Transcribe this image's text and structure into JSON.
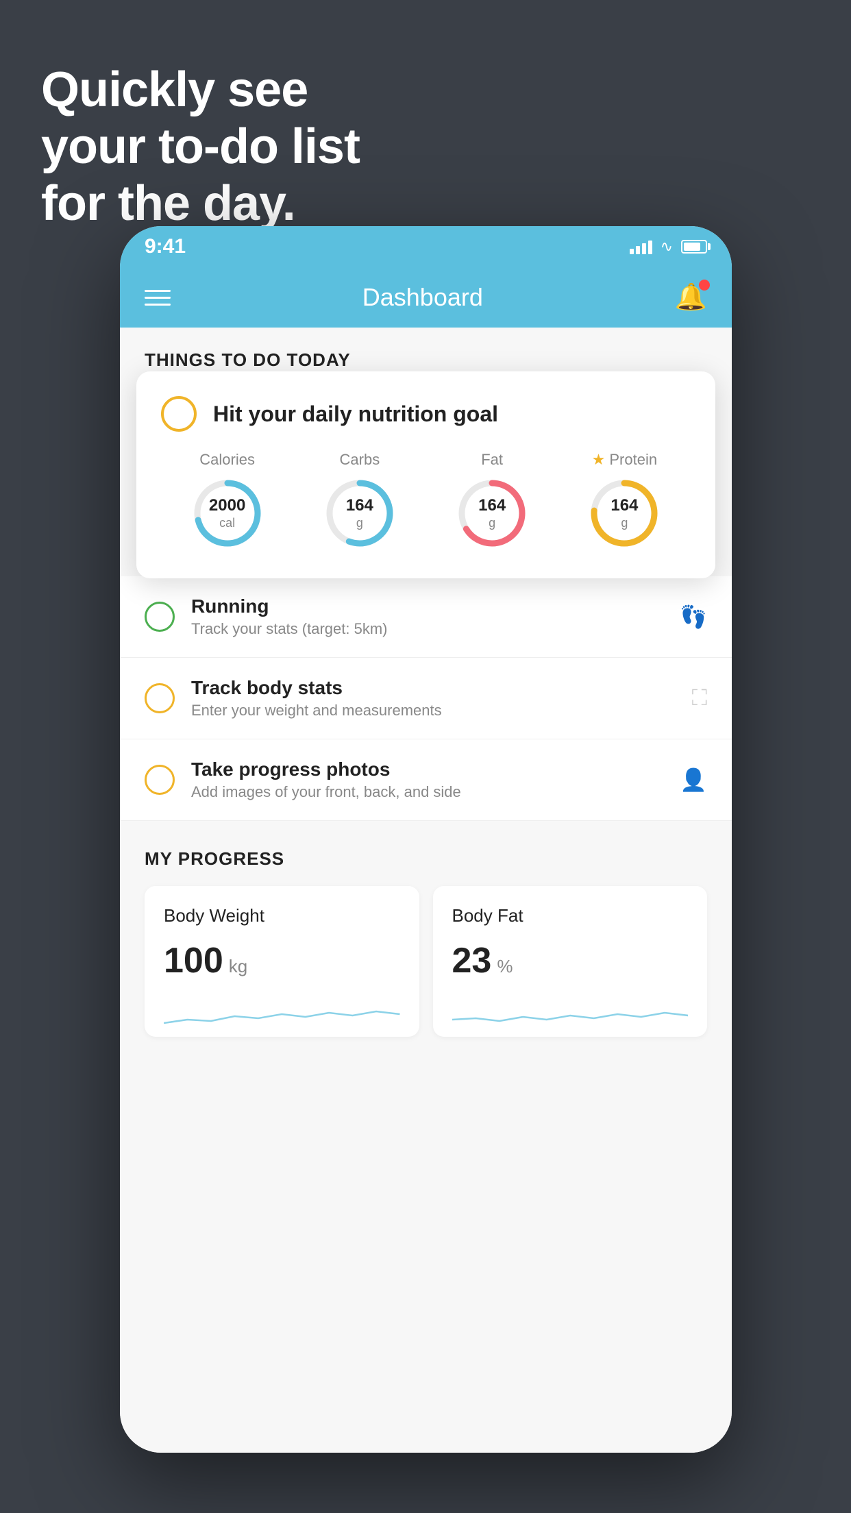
{
  "headline": {
    "line1": "Quickly see",
    "line2": "your to-do list",
    "line3": "for the day."
  },
  "status_bar": {
    "time": "9:41"
  },
  "header": {
    "title": "Dashboard"
  },
  "things_section": {
    "title": "THINGS TO DO TODAY"
  },
  "featured_card": {
    "title": "Hit your daily nutrition goal",
    "stats": [
      {
        "label": "Calories",
        "value": "2000",
        "unit": "cal",
        "color": "#5bbfde",
        "percent": 70
      },
      {
        "label": "Carbs",
        "value": "164",
        "unit": "g",
        "color": "#5bbfde",
        "percent": 55
      },
      {
        "label": "Fat",
        "value": "164",
        "unit": "g",
        "color": "#f26b7a",
        "percent": 65
      },
      {
        "label": "Protein",
        "value": "164",
        "unit": "g",
        "color": "#f0b429",
        "percent": 75,
        "star": true
      }
    ]
  },
  "todo_items": [
    {
      "name": "Running",
      "desc": "Track your stats (target: 5km)",
      "circle_color": "green",
      "icon": "shoe"
    },
    {
      "name": "Track body stats",
      "desc": "Enter your weight and measurements",
      "circle_color": "yellow",
      "icon": "scale"
    },
    {
      "name": "Take progress photos",
      "desc": "Add images of your front, back, and side",
      "circle_color": "yellow",
      "icon": "person"
    }
  ],
  "progress_section": {
    "title": "MY PROGRESS",
    "cards": [
      {
        "title": "Body Weight",
        "value": "100",
        "unit": "kg"
      },
      {
        "title": "Body Fat",
        "value": "23",
        "unit": "%"
      }
    ]
  }
}
